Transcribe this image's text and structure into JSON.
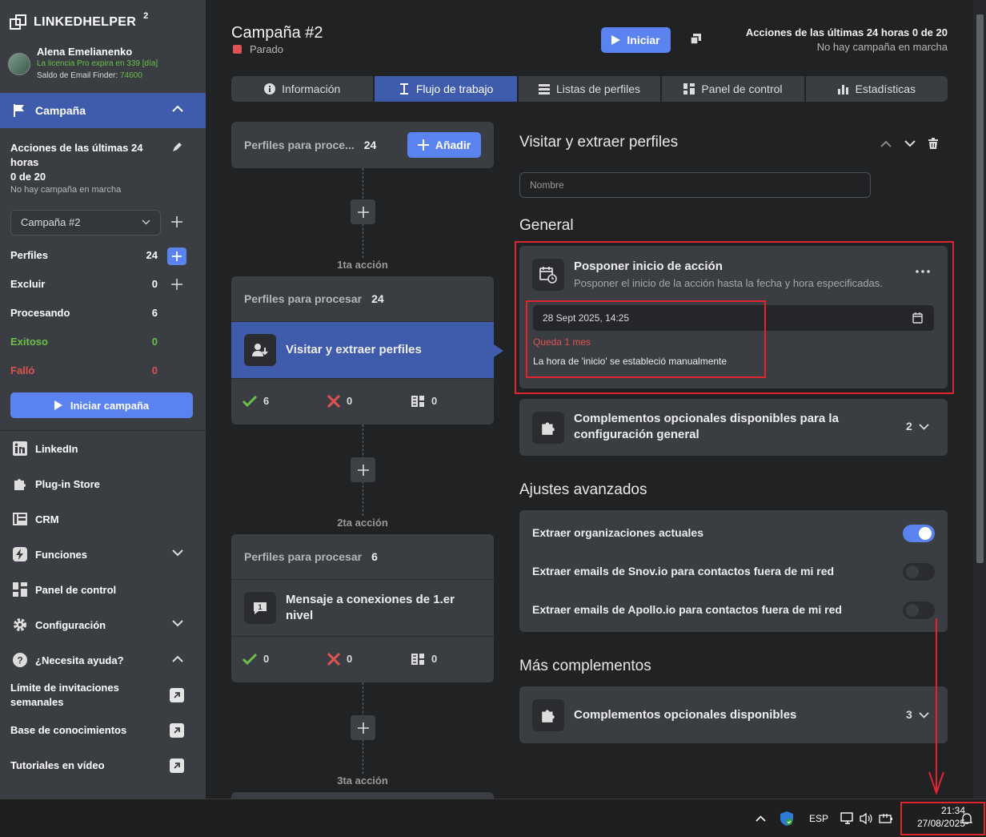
{
  "sidebar": {
    "logo": "LINKEDHELPER",
    "logo_sup": "2",
    "user_name": "Alena Emelianenko",
    "license": "La licencia Pro expira en 339 [día]",
    "saldo_label": "Saldo de Email Finder:",
    "saldo_value": "74600",
    "campaign_header": "Campaña",
    "actions_text": "Acciones de las últimas 24 horas",
    "actions_count": "0 de 20",
    "no_campaign": "No hay campaña en marcha",
    "campaign_select": "Campaña #2",
    "stats": [
      {
        "label": "Perfiles",
        "value": "24"
      },
      {
        "label": "Excluir",
        "value": "0"
      },
      {
        "label": "Procesando",
        "value": "6"
      },
      {
        "label": "Exitoso",
        "value": "0"
      },
      {
        "label": "Falló",
        "value": "0"
      }
    ],
    "start_campaign": "Iniciar campaña",
    "nav": [
      "LinkedIn",
      "Plug-in Store",
      "CRM",
      "Funciones",
      "Panel de control",
      "Configuración",
      "¿Necesita ayuda?"
    ],
    "help_items": [
      "Límite de invitaciones semanales",
      "Base de conocimientos",
      "Tutoriales en vídeo"
    ]
  },
  "header": {
    "title": "Campaña #2",
    "status": "Parado",
    "start": "Iniciar",
    "actions_line": "Acciones de las últimas 24 horas 0 de 20",
    "no_campaign": "No hay campaña en marcha"
  },
  "tabs": [
    "Información",
    "Flujo de trabajo",
    "Listas de perfiles",
    "Panel de control",
    "Estadísticas"
  ],
  "workflow": {
    "start_card": {
      "label": "Perfiles para proce...",
      "count": "24",
      "add": "Añadir"
    },
    "steps": [
      {
        "step_label": "1ta acción",
        "pending_label": "Perfiles para procesar",
        "pending": "24",
        "action": "Visitar y extraer perfiles",
        "ok": "6",
        "fail": "0",
        "skip": "0"
      },
      {
        "step_label": "2ta acción",
        "pending_label": "Perfiles para procesar",
        "pending": "6",
        "action": "Mensaje a conexiones de 1.er nivel",
        "ok": "0",
        "fail": "0",
        "skip": "0"
      }
    ],
    "next_label": "3ta acción"
  },
  "detail": {
    "title": "Visitar y extraer perfiles",
    "name_placeholder": "Nombre",
    "general": "General",
    "postpone_title": "Posponer inicio de acción",
    "postpone_sub": "Posponer el inicio de la acción hasta la fecha y hora especificadas.",
    "date_value": "28 Sept 2025, 14:25",
    "remaining": "Queda 1 mes",
    "manual_note": "La hora de 'inicio' se estableció manualmente",
    "optional_general": "Complementos opcionales disponibles para la configuración general",
    "optional_general_count": "2",
    "advanced": "Ajustes avanzados",
    "toggles": [
      {
        "label": "Extraer organizaciones actuales",
        "on": true
      },
      {
        "label": "Extraer emails de Snov.io para contactos fuera de mi red",
        "on": false
      },
      {
        "label": "Extraer emails de Apollo.io para contactos fuera de mi red",
        "on": false
      }
    ],
    "more": "Más complementos",
    "optional": "Complementos opcionales disponibles",
    "optional_count": "3"
  },
  "taskbar": {
    "lang": "ESP",
    "time": "21:34",
    "date": "27/08/2025"
  },
  "colors": {
    "accent": "#5b83f0",
    "selected": "#3f5bab",
    "success": "#6cc04a",
    "danger": "#e05252",
    "highlight": "#e02430"
  }
}
